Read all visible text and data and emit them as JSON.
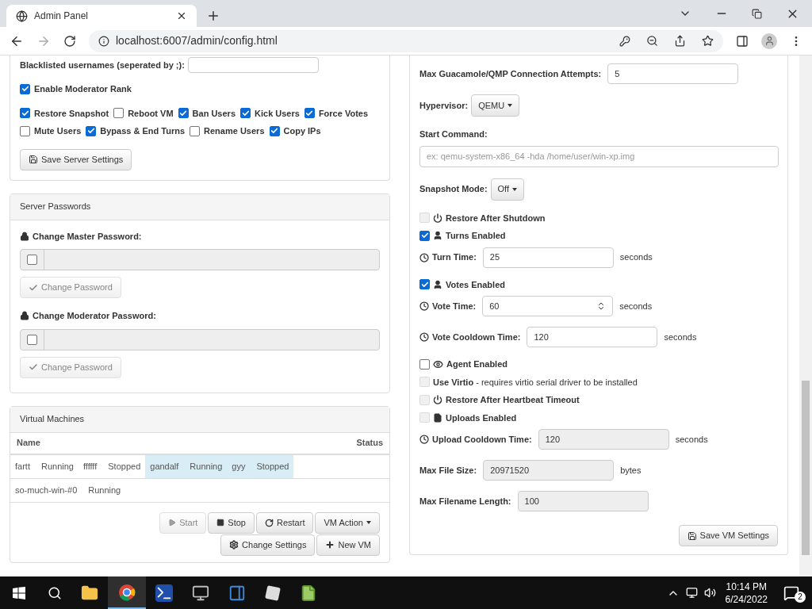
{
  "browser": {
    "tab_title": "Admin Panel",
    "url": "localhost:6007/admin/config.html"
  },
  "server_settings": {
    "blacklist_label": "Blacklisted usernames (seperated by ;):",
    "moderator_rank": {
      "label": "Enable Moderator Rank",
      "checked": true
    },
    "permissions": [
      {
        "label": "Restore Snapshot",
        "checked": true
      },
      {
        "label": "Reboot VM",
        "checked": false
      },
      {
        "label": "Ban Users",
        "checked": true
      },
      {
        "label": "Kick Users",
        "checked": true
      },
      {
        "label": "Force Votes",
        "checked": true
      },
      {
        "label": "Mute Users",
        "checked": false
      },
      {
        "label": "Bypass & End Turns",
        "checked": true
      },
      {
        "label": "Rename Users",
        "checked": false
      },
      {
        "label": "Copy IPs",
        "checked": true
      }
    ],
    "save_button": "Save Server Settings"
  },
  "server_passwords": {
    "title": "Server Passwords",
    "groups": [
      {
        "label": "Change Master Password:",
        "enabled": false,
        "button": "Change Password"
      },
      {
        "label": "Change Moderator Password:",
        "enabled": false,
        "button": "Change Password"
      }
    ]
  },
  "virtual_machines": {
    "title": "Virtual Machines",
    "columns": [
      "Name",
      "Status"
    ],
    "rows": [
      {
        "name": "fartt",
        "status": "Running",
        "selected": false
      },
      {
        "name": "ffffff",
        "status": "Stopped",
        "selected": false
      },
      {
        "name": "gandalf",
        "status": "Running",
        "selected": true
      },
      {
        "name": "gyy",
        "status": "Stopped",
        "selected": true
      },
      {
        "name": "so-much-win-#0",
        "status": "Running",
        "selected": false
      }
    ],
    "buttons": [
      {
        "kind": "start",
        "label": "Start",
        "disabled": true
      },
      {
        "kind": "stop",
        "label": "Stop",
        "disabled": false
      },
      {
        "kind": "restart",
        "label": "Restart",
        "disabled": false
      },
      {
        "kind": "dropdown",
        "label": "VM Action",
        "disabled": false
      },
      {
        "kind": "settings",
        "label": "Change Settings",
        "disabled": false
      },
      {
        "kind": "new",
        "label": "New VM",
        "disabled": false
      }
    ]
  },
  "vm_settings": {
    "items": [
      {
        "kind": "input",
        "label": "Max Guacamole/QMP Connection Attempts:",
        "value": "5",
        "disabled": false
      },
      {
        "kind": "dropdown",
        "label": "Hypervisor:",
        "value": "QEMU"
      },
      {
        "kind": "wide_input",
        "label": "Start Command:",
        "placeholder": "ex: qemu-system-x86_64 -hda /home/user/win-xp.img"
      },
      {
        "kind": "dropdown",
        "label": "Snapshot Mode:",
        "value": "Off"
      },
      {
        "kind": "checkbox",
        "label": "Restore After Shutdown",
        "checked": false,
        "disabled": true
      },
      {
        "kind": "checkbox",
        "label": "Turns Enabled",
        "checked": true,
        "disabled": false
      },
      {
        "kind": "input",
        "label": "Turn Time:",
        "value": "25",
        "unit": "seconds",
        "disabled": false
      },
      {
        "kind": "checkbox",
        "label": "Votes Enabled",
        "checked": true,
        "disabled": false
      },
      {
        "kind": "input",
        "label": "Vote Time:",
        "value": "60",
        "unit": "seconds",
        "disabled": false,
        "spinner": true
      },
      {
        "kind": "input",
        "label": "Vote Cooldown Time:",
        "value": "120",
        "unit": "seconds",
        "disabled": false
      },
      {
        "kind": "checkbox",
        "label": "Agent Enabled",
        "checked": false,
        "disabled": false
      },
      {
        "kind": "checkbox",
        "label": "**Use Virtio** - requires virtio serial driver to be installed",
        "checked": false,
        "disabled": true
      },
      {
        "kind": "checkbox",
        "label": "Restore After Heartbeat Timeout",
        "checked": false,
        "disabled": true
      },
      {
        "kind": "checkbox",
        "label": "Uploads Enabled",
        "checked": false,
        "disabled": true
      },
      {
        "kind": "input",
        "label": "Upload Cooldown Time:",
        "value": "120",
        "unit": "seconds",
        "disabled": true
      },
      {
        "kind": "input",
        "label": "Max File Size:",
        "value": "20971520",
        "unit": "bytes",
        "disabled": true
      },
      {
        "kind": "input",
        "label": "Max Filename Length:",
        "value": "100",
        "disabled": true
      }
    ],
    "save_button": "Save VM Settings"
  },
  "taskbar": {
    "time": "10:14 PM",
    "date": "6/24/2022",
    "notifications": "2"
  }
}
